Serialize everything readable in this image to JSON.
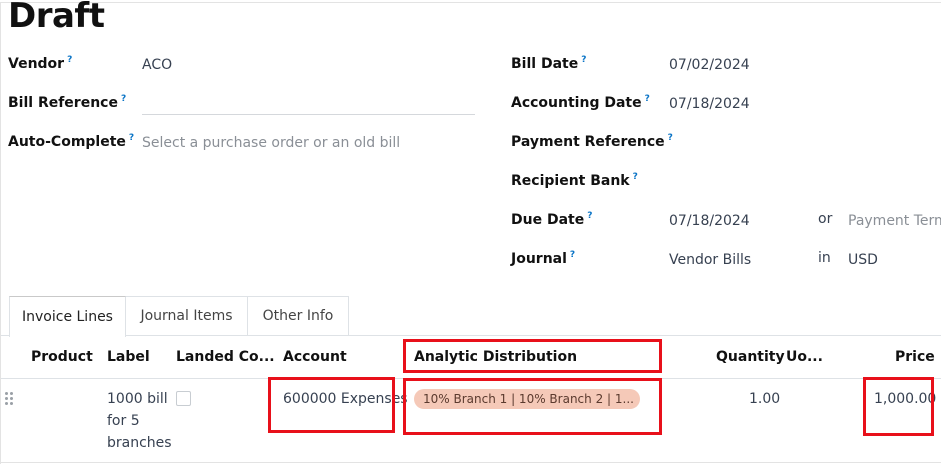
{
  "page": {
    "title": "Draft"
  },
  "form_left": {
    "vendor_label": "Vendor",
    "vendor_value": "ACO",
    "bill_reference_label": "Bill Reference",
    "bill_reference_value": "",
    "auto_complete_label": "Auto-Complete",
    "auto_complete_placeholder": "Select a purchase order or an old bill"
  },
  "form_right": {
    "bill_date_label": "Bill Date",
    "bill_date_value": "07/02/2024",
    "accounting_date_label": "Accounting Date",
    "accounting_date_value": "07/18/2024",
    "payment_reference_label": "Payment Reference",
    "recipient_bank_label": "Recipient Bank",
    "due_date_label": "Due Date",
    "due_date_value": "07/18/2024",
    "or_text": "or",
    "payment_terms_placeholder": "Payment Terms",
    "journal_label": "Journal",
    "journal_value": "Vendor Bills",
    "in_text": "in",
    "currency_value": "USD"
  },
  "help_marker": "?",
  "tabs": [
    {
      "label": "Invoice Lines",
      "active": true
    },
    {
      "label": "Journal Items",
      "active": false
    },
    {
      "label": "Other Info",
      "active": false
    }
  ],
  "table": {
    "columns": [
      "Product",
      "Label",
      "Landed Co...",
      "Account",
      "Analytic Distribution",
      "Quantity",
      "Uo...",
      "Price"
    ],
    "rows": [
      {
        "product": "",
        "label_lines": [
          "1000 bill",
          "for 5",
          "branches"
        ],
        "landed_cost": false,
        "account": "600000 Expenses",
        "analytic_distribution": "10% Branch 1 | 10% Branch 2 | 1...",
        "quantity": "1.00",
        "uom": "",
        "price": "1,000.00"
      }
    ]
  },
  "colors": {
    "highlight_box": "#e8101a",
    "analytic_tag_bg": "#f5c9b8",
    "help_icon": "#0a74c6"
  }
}
